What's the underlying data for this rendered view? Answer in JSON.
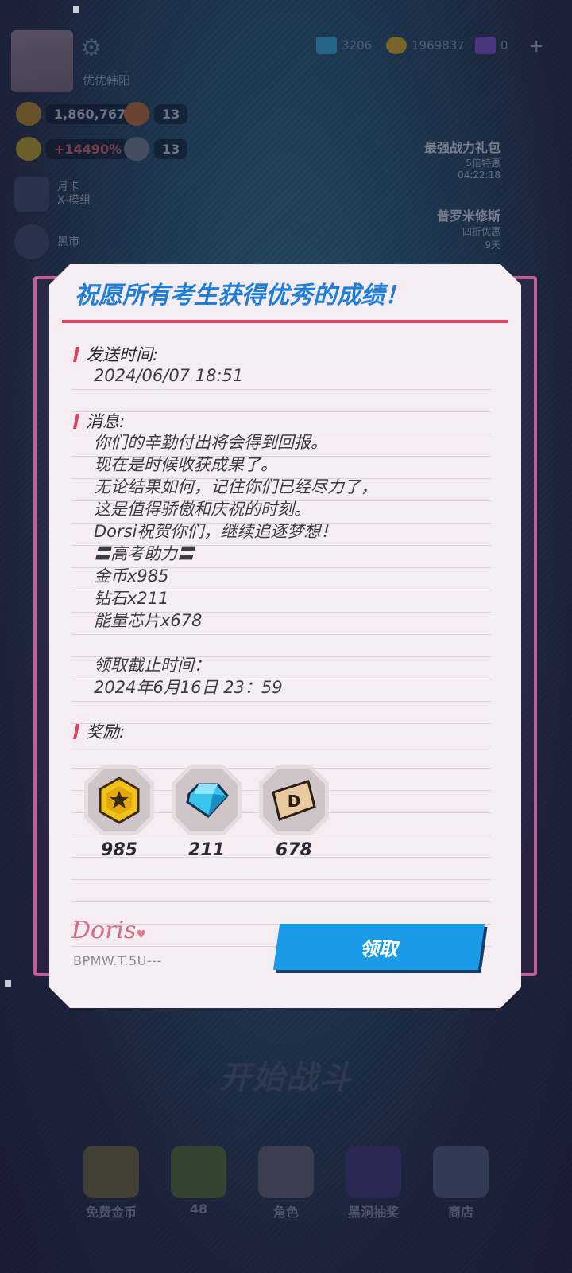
{
  "hud": {
    "player_name": "优优韩阳",
    "currencies": [
      {
        "icon": "diamond-icon",
        "value": "3206",
        "color": "#3aa6d8"
      },
      {
        "icon": "gold-coin-icon",
        "value": "1969837",
        "color": "#d1a52c"
      },
      {
        "icon": "purple-gem-icon",
        "value": "0",
        "color": "#7b4fc4"
      }
    ],
    "trophy_value": "1,860,767",
    "fist_value": "13",
    "bonus_value": "+14490%",
    "sword_value": "13",
    "side_items": [
      {
        "icon": "monthly-card-icon",
        "label_1": "月卡",
        "label_2": "X-模组"
      },
      {
        "icon": "spade-ace-icon",
        "label_1": "黑市",
        "label_2": ""
      }
    ],
    "promos": [
      {
        "title": "最强战力礼包",
        "sub": "5倍特惠",
        "timer": "04:22:18"
      },
      {
        "title": "普罗米修斯",
        "sub": "四折优惠",
        "timer": "9天"
      }
    ],
    "start_battle": "开始战斗",
    "nav": [
      {
        "icon": "free-coins-icon",
        "label": "免费金币"
      },
      {
        "icon": "level-icon",
        "label": "48"
      },
      {
        "icon": "character-icon",
        "label": "角色"
      },
      {
        "icon": "ss-gacha-icon",
        "label": "黑洞抽奖"
      },
      {
        "icon": "shop-icon",
        "label": "商店"
      }
    ]
  },
  "mail": {
    "title": "祝愿所有考生获得优秀的成绩！",
    "sent_time_label": "发送时间:",
    "sent_time": "2024/06/07 18:51",
    "message_label": "消息:",
    "message_lines": [
      "你们的辛勤付出将会得到回报。",
      "现在是时候收获成果了。",
      "无论结果如何，记住你们已经尽力了，",
      "这是值得骄傲和庆祝的时刻。",
      "Dorsi祝贺你们，继续追逐梦想！",
      "〓高考助力〓",
      "金币x985",
      "钻石x211",
      "能量芯片x678",
      "",
      "领取截止时间：",
      "2024年6月16日 23：59"
    ],
    "rewards_label": "奖励:",
    "rewards": [
      {
        "icon": "gold-coin-icon",
        "count": "985"
      },
      {
        "icon": "diamond-icon",
        "count": "211"
      },
      {
        "icon": "energy-chip-icon",
        "count": "678"
      }
    ],
    "signature": "Doris",
    "uid": "BPMW.T.5U---",
    "claim_label": "领取"
  }
}
